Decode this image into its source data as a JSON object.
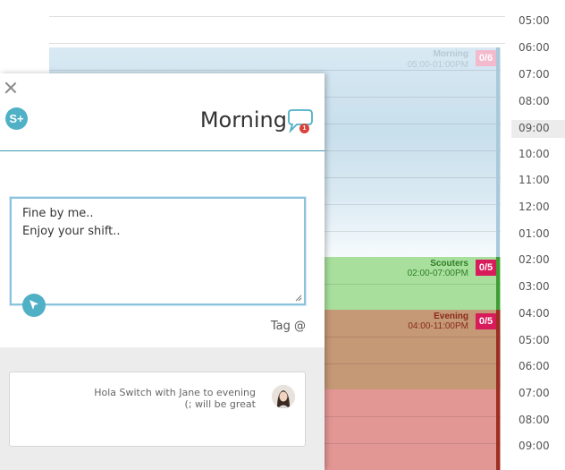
{
  "times": [
    "05:00",
    "06:00",
    "07:00",
    "08:00",
    "09:00",
    "10:00",
    "11:00",
    "12:00",
    "01:00",
    "02:00",
    "03:00",
    "04:00",
    "05:00",
    "06:00",
    "07:00",
    "08:00",
    "09:00"
  ],
  "shifts": {
    "morning": {
      "name": "Morning",
      "time": "05:00-01:00PM",
      "badge": "0/6",
      "color": "#c8dfec",
      "badge_color": "#f3b9cc"
    },
    "scouters": {
      "name": "Scouters",
      "time": "02:00-07:00PM",
      "badge": "0/5",
      "color": "#a8df9d",
      "badge_color": "#d81b5a"
    },
    "evening": {
      "name": "Evening",
      "time": "04:00-11:00PM",
      "badge": "0/5",
      "color": "#c59876",
      "badge_color": "#d81b5a"
    }
  },
  "panel": {
    "s_plus": "S+",
    "title": "Morning",
    "chat_count": "1",
    "message_lines": [
      "Fine by me..",
      "Enjoy your shift.."
    ],
    "tag_label": "Tag @",
    "comment_lines": [
      "Hola Switch with Jane to evening",
      "(; will be great"
    ]
  },
  "colors": {
    "accent": "#4fb0c6",
    "rule": "#3e98b3"
  }
}
